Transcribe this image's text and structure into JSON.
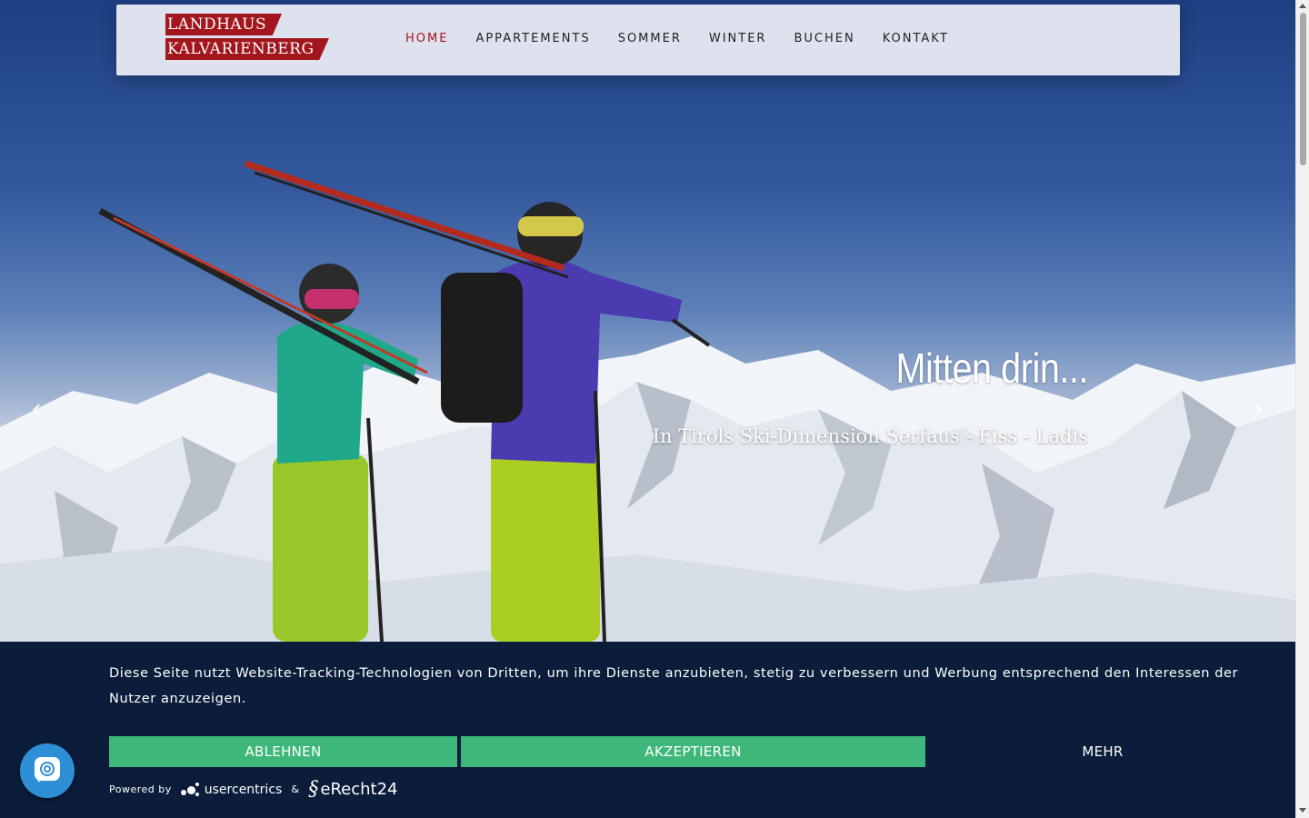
{
  "logo": {
    "line1": "LANDHAUS",
    "line2": "KALVARIENBERG",
    "brand_color": "#a3161d"
  },
  "nav": {
    "items": [
      {
        "label": "HOME",
        "active": true
      },
      {
        "label": "APPARTEMENTS",
        "active": false
      },
      {
        "label": "SOMMER",
        "active": false
      },
      {
        "label": "WINTER",
        "active": false
      },
      {
        "label": "BUCHEN",
        "active": false
      },
      {
        "label": "KONTAKT",
        "active": false
      }
    ]
  },
  "hero": {
    "title": "Mitten drin...",
    "subtitle": "In Tirols Ski-Dimension Serfaus - Fiss - Ladis",
    "prev_icon": "chevron-left-icon",
    "next_icon": "chevron-right-icon"
  },
  "cookie": {
    "text": "Diese Seite nutzt Website-Tracking-Technologien von Dritten, um ihre Dienste anzubieten, stetig zu verbessern und Werbung entsprechend den Interessen der Nutzer anzuzeigen.",
    "deny_label": "ABLEHNEN",
    "accept_label": "AKZEPTIEREN",
    "more_label": "MEHR",
    "powered_by": "Powered by",
    "usercentrics": "usercentrics",
    "ampersand": "&",
    "erecht": "eRecht24",
    "button_color": "#3db77a",
    "background_color": "#0b1d3a"
  },
  "privacy_button": {
    "icon": "fingerprint-chat-icon",
    "color": "#2f8fd6"
  }
}
